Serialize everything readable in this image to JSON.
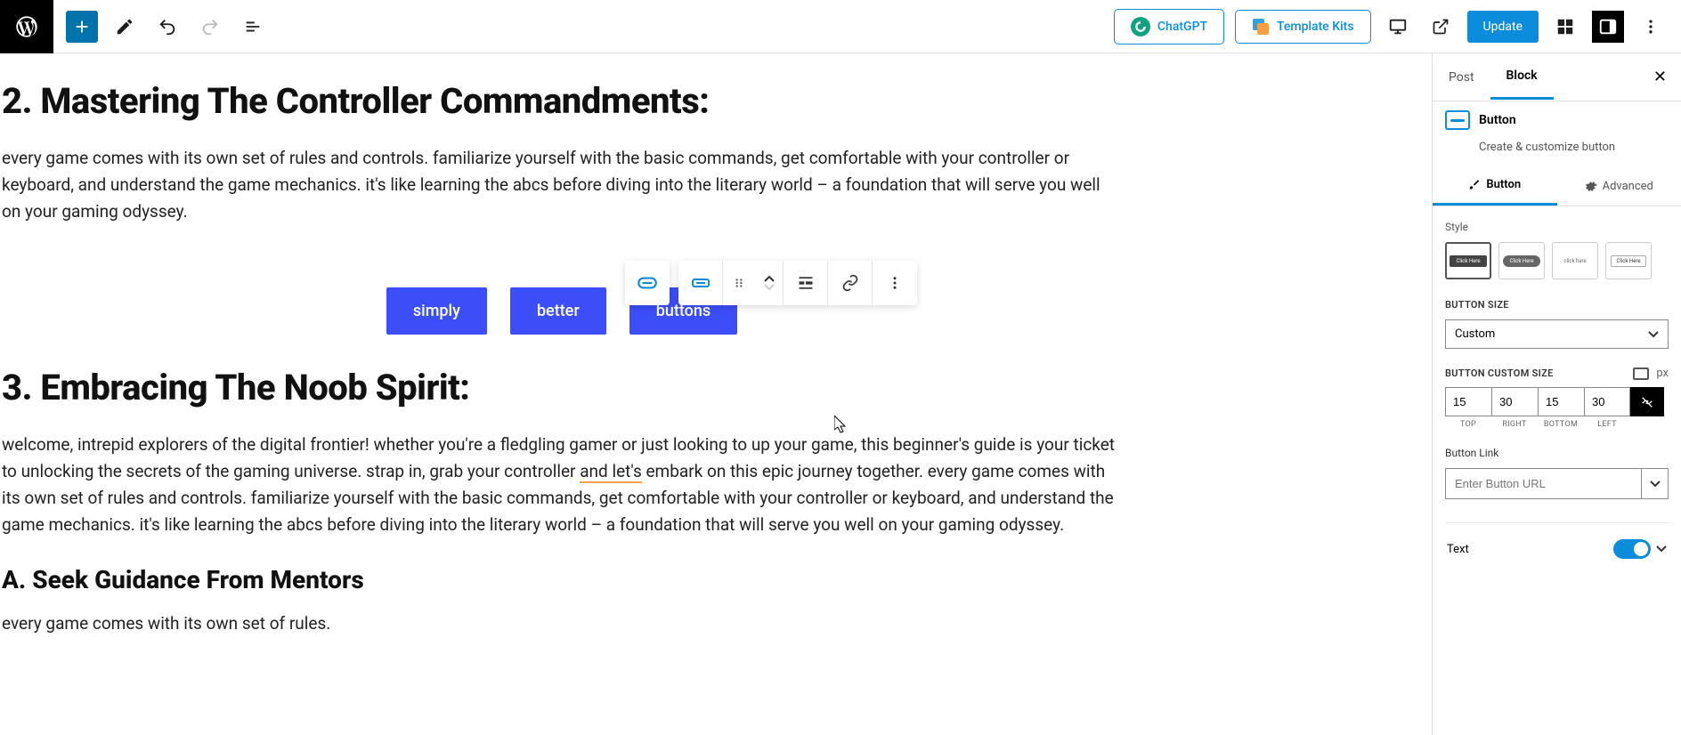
{
  "topbar": {
    "chatgpt": "ChatGPT",
    "templateKits": "Template Kits",
    "update": "Update"
  },
  "content": {
    "h2_1": "2. Mastering The Controller Commandments:",
    "p1": "every game comes with its own set of rules and controls. familiarize yourself with the basic commands, get comfortable with your controller or keyboard, and understand the game mechanics. it's like learning the abcs before diving into the literary world – a foundation that will serve you well on your gaming odyssey.",
    "buttons": [
      "simply",
      "better",
      "buttons"
    ],
    "h2_2": "3. Embracing The Noob Spirit:",
    "p2a": "welcome, intrepid explorers of the digital frontier! whether you're a fledgling gamer or just looking to up your game, this beginner's guide is your ticket to unlocking the secrets of the gaming universe. strap in, grab your controller ",
    "p2_underlined": "and let's",
    "p2b": " embark on this epic journey together. every game comes with its own set of rules and controls. familiarize yourself with the basic commands, get comfortable with your controller or keyboard, and understand the game mechanics. it's like learning the abcs before diving into the literary world – a foundation that will serve you well on your gaming odyssey.",
    "h3_1": "A. Seek Guidance From Mentors",
    "p3": "every game comes with its own set of rules."
  },
  "sidebar": {
    "tabs": {
      "post": "Post",
      "block": "Block"
    },
    "blockTitle": "Button",
    "blockDesc": "Create & customize button",
    "subtabs": {
      "button": "Button",
      "advanced": "Advanced"
    },
    "styleLabel": "Style",
    "sizeLabel": "BUTTON SIZE",
    "sizeValue": "Custom",
    "customSizeLabel": "BUTTON CUSTOM SIZE",
    "unit": "px",
    "padding": {
      "top": "15",
      "right": "30",
      "bottom": "15",
      "left": "30"
    },
    "padLabels": {
      "top": "TOP",
      "right": "RIGHT",
      "bottom": "BOTTOM",
      "left": "LEFT"
    },
    "buttonLinkLabel": "Button Link",
    "buttonLinkPlaceholder": "Enter Button URL",
    "textLabel": "Text"
  }
}
